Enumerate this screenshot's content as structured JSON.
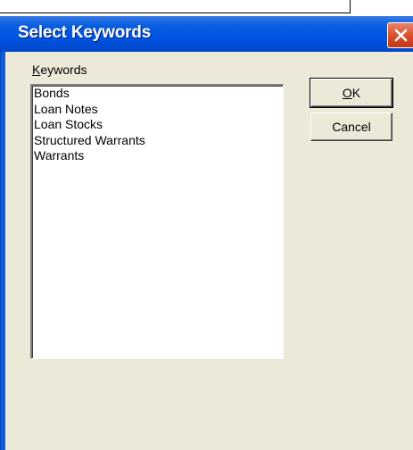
{
  "dialog": {
    "title": "Select Keywords",
    "close_icon": "close-x-icon",
    "keywords_label": "Keywords",
    "keywords_label_mnemonic": "K",
    "keywords_label_rest": "eywords",
    "items": [
      "Bonds",
      "Loan Notes",
      "Loan Stocks",
      "Structured Warrants",
      "Warrants"
    ],
    "ok_label": "OK",
    "ok_mnemonic": "O",
    "ok_rest": "K",
    "cancel_label": "Cancel"
  },
  "colors": {
    "titlebar": "#0054e3",
    "dialog_bg": "#ece9d8",
    "close_button": "#d64a22"
  }
}
